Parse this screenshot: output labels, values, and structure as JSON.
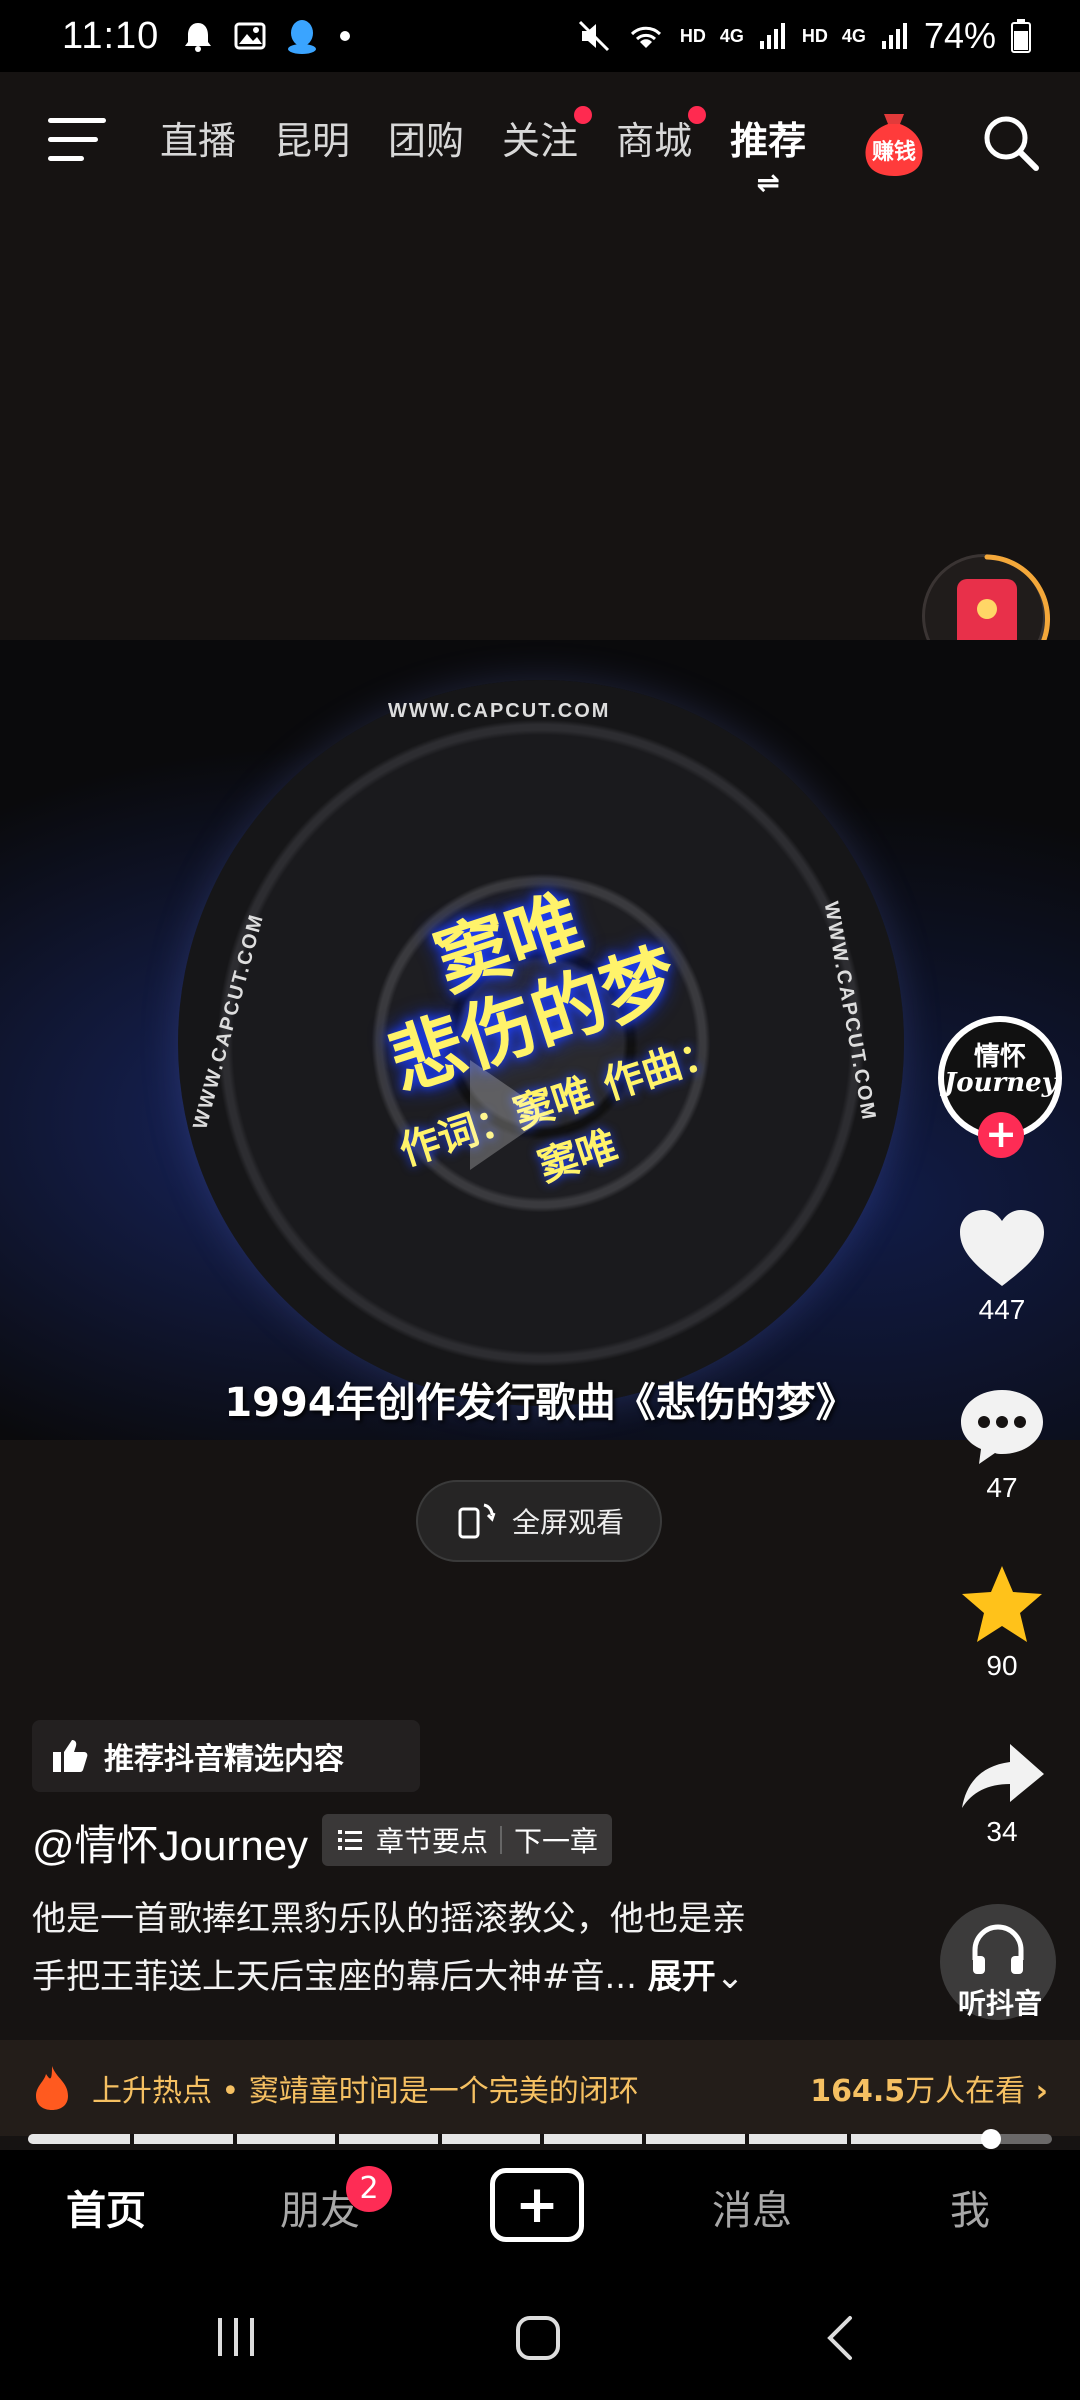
{
  "status_bar": {
    "time": "11:10",
    "network_labels": [
      "HD",
      "4G",
      "HD",
      "4G"
    ],
    "battery": "74%",
    "icons": [
      "alarm-icon",
      "gallery-icon",
      "qq-icon",
      "dot-icon",
      "mute-icon",
      "wifi-icon",
      "signal-icon",
      "battery-icon"
    ]
  },
  "top_nav": {
    "tabs": [
      {
        "label": "直播",
        "dot": false
      },
      {
        "label": "昆明",
        "dot": false
      },
      {
        "label": "团购",
        "dot": false
      },
      {
        "label": "关注",
        "dot": true
      },
      {
        "label": "商城",
        "dot": true
      },
      {
        "label": "推荐",
        "dot": false,
        "active": true
      }
    ],
    "earn_label": "赚钱",
    "accent_color": "#fe2c55"
  },
  "video": {
    "disc_title": "窦唯",
    "disc_song": "悲伤的梦",
    "disc_credits": "作词：窦唯  作曲：窦唯",
    "rim_text": "WWW.CAPCUT.COM",
    "caption": "1994年创作发行歌曲《悲伤的梦》"
  },
  "fullscreen_label": "全屏观看",
  "actions": {
    "likes": "447",
    "comments": "47",
    "favorites": "90",
    "shares": "34",
    "listen_label": "听抖音"
  },
  "author": {
    "avatar_line1": "情怀",
    "avatar_line2": "Journey",
    "handle": "@情怀Journey"
  },
  "tag_pill": "推荐抖音精选内容",
  "chapter": {
    "outline_label": "章节要点",
    "next_label": "下一章"
  },
  "description": {
    "line1": "他是一首歌捧红黑豹乐队的摇滚教父，他也是亲",
    "line2": "手把王菲送上天后宝座的幕后大神#音...",
    "expand_label": "展开"
  },
  "hot": {
    "text": "上升热点 • 窦靖童时间是一个完美的闭环",
    "viewers_number": "164.5",
    "viewers_unit": "万人在看",
    "color": "#f5c062"
  },
  "progress": {
    "value": 0.94
  },
  "bottom_nav": {
    "home": "首页",
    "friends": "朋友",
    "friends_badge": "2",
    "messages": "消息",
    "me": "我"
  }
}
